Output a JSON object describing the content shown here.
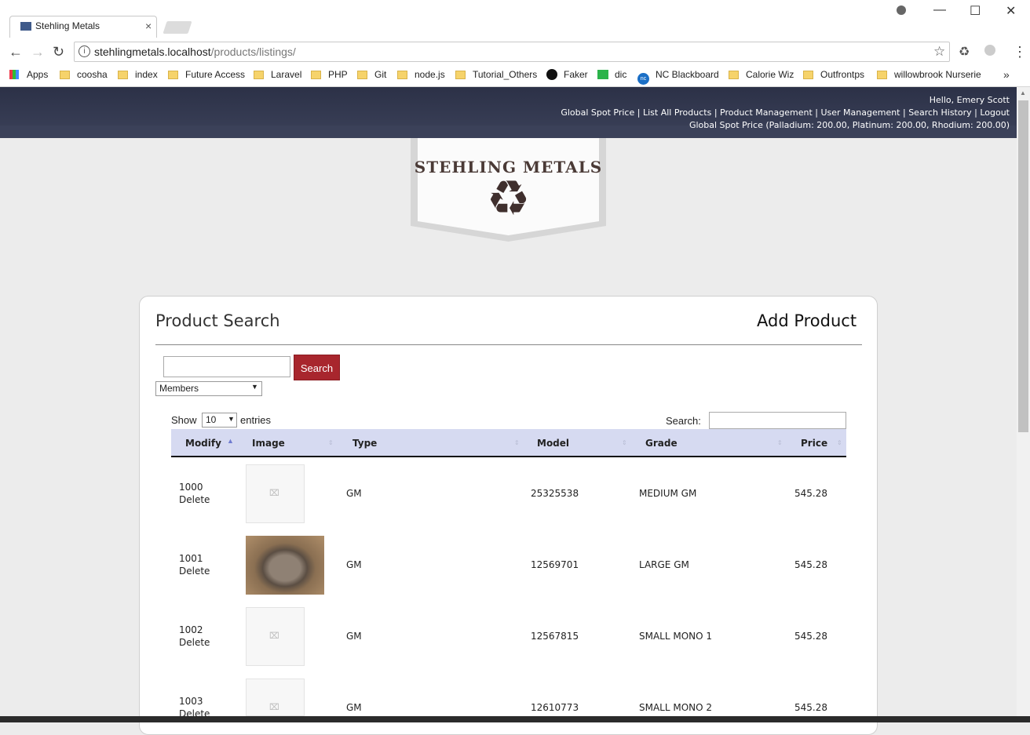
{
  "browser": {
    "tab_title": "Stehling Metals",
    "url_host": "stehlingmetals.localhost",
    "url_path": "/products/listings/",
    "window_controls": {
      "minimize": "—",
      "maximize": "☐",
      "close": "✕"
    },
    "bookmarks": [
      {
        "label": "Apps",
        "icon": "apps-icon"
      },
      {
        "label": "coosha",
        "icon": "folder-icon"
      },
      {
        "label": "index",
        "icon": "folder-icon"
      },
      {
        "label": "Future Access",
        "icon": "folder-icon"
      },
      {
        "label": "Laravel",
        "icon": "folder-icon"
      },
      {
        "label": "PHP",
        "icon": "folder-icon"
      },
      {
        "label": "Git",
        "icon": "folder-icon"
      },
      {
        "label": "node.js",
        "icon": "folder-icon"
      },
      {
        "label": "Tutorial_Others",
        "icon": "folder-icon"
      },
      {
        "label": "Faker",
        "icon": "github-icon"
      },
      {
        "label": "dic",
        "icon": "dict-icon"
      },
      {
        "label": "NC Blackboard",
        "icon": "nc-icon"
      },
      {
        "label": "Calorie Wiz",
        "icon": "folder-icon"
      },
      {
        "label": "Outfrontps",
        "icon": "folder-icon"
      },
      {
        "label": "willowbrook Nurserie",
        "icon": "folder-icon"
      }
    ],
    "bookmarks_overflow": "»"
  },
  "header": {
    "greeting": "Hello, Emery Scott",
    "nav": [
      "Global Spot Price",
      "List All Products",
      "Product Management",
      "User Management",
      "Search History",
      "Logout"
    ],
    "nav_separator": " | ",
    "spot_price_line": "Global Spot Price (Palladium: 200.00, Platinum: 200.00, Rhodium: 200.00)"
  },
  "logo": {
    "text": "STEHLING METALS",
    "icon": "recycle-icon"
  },
  "card": {
    "title": "Product Search",
    "add_product": "Add Product",
    "search_button": "Search",
    "search_value": "",
    "member_filter": "Members",
    "show_label": "Show",
    "entries_value": "10",
    "entries_label": "entries",
    "filter_label": "Search:",
    "filter_value": ""
  },
  "table": {
    "columns": [
      "Modify",
      "Image",
      "Type",
      "Model",
      "Grade",
      "Price"
    ],
    "delete_label": "Delete",
    "rows": [
      {
        "id": "1000",
        "image": "placeholder",
        "type": "GM",
        "model": "25325538",
        "grade": "MEDIUM GM",
        "price": "545.28"
      },
      {
        "id": "1001",
        "image": "photo",
        "type": "GM",
        "model": "12569701",
        "grade": "LARGE GM",
        "price": "545.28"
      },
      {
        "id": "1002",
        "image": "placeholder",
        "type": "GM",
        "model": "12567815",
        "grade": "SMALL MONO 1",
        "price": "545.28"
      },
      {
        "id": "1003",
        "image": "placeholder",
        "type": "GM",
        "model": "12610773",
        "grade": "SMALL MONO 2",
        "price": "545.28"
      }
    ]
  },
  "colors": {
    "header_bg": "#2c3147",
    "table_header_bg": "#d6daf1",
    "search_button_bg": "#a8262d",
    "logo_text": "#4a3a36"
  }
}
